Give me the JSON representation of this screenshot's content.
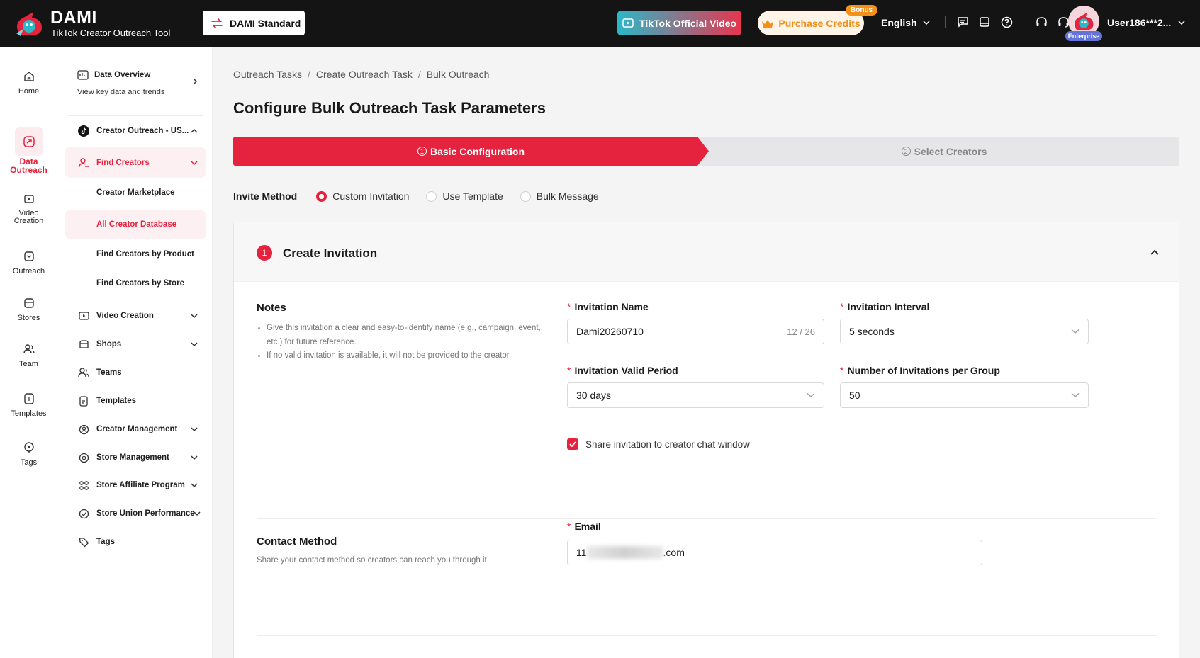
{
  "header": {
    "brand_name": "DAMI",
    "brand_sub": "TikTok Creator Outreach Tool",
    "plan_label": "DAMI Standard",
    "video_button": "TikTok Official Video",
    "credits_button": "Purchase Credits",
    "bonus_badge": "Bonus",
    "language": "English",
    "enterprise_badge": "Enterprise",
    "username": "User186***2...",
    "icons": [
      "chat-icon",
      "screen-icon",
      "help-icon",
      "headset-icon",
      "support-icon"
    ]
  },
  "rail": {
    "items": [
      {
        "label": "Home",
        "icon": "home-icon"
      },
      {
        "label": "Data Outreach",
        "icon": "outreach-icon",
        "active": true
      },
      {
        "label": "Video Creation",
        "icon": "video-icon"
      },
      {
        "label": "Outreach",
        "icon": "mail-icon"
      },
      {
        "label": "Stores",
        "icon": "store-icon"
      },
      {
        "label": "Team",
        "icon": "team-icon"
      },
      {
        "label": "Templates",
        "icon": "template-icon"
      },
      {
        "label": "Tags",
        "icon": "tag-icon"
      }
    ]
  },
  "subnav": {
    "data_overview_title": "Data Overview",
    "data_overview_sub": "View key data and trends",
    "creator_outreach": "Creator Outreach - US...",
    "find_creators": "Find Creators",
    "creator_marketplace": "Creator Marketplace",
    "all_creator_database": "All Creator Database",
    "find_by_product": "Find Creators by Product",
    "find_by_store": "Find Creators by Store",
    "video_creation": "Video Creation",
    "shops": "Shops",
    "teams": "Teams",
    "templates": "Templates",
    "creator_management": "Creator Management",
    "store_management": "Store Management",
    "store_affiliate": "Store Affiliate Program",
    "store_union": "Store Union Performance",
    "tags": "Tags"
  },
  "main": {
    "breadcrumb": [
      "Outreach Tasks",
      "Create Outreach Task",
      "Bulk Outreach"
    ],
    "title": "Configure Bulk Outreach Task Parameters",
    "steps": [
      {
        "num": "1",
        "label": "Basic Configuration",
        "active": true
      },
      {
        "num": "2",
        "label": "Select Creators",
        "active": false
      }
    ],
    "invite_method_label": "Invite Method",
    "invite_methods": [
      {
        "label": "Custom Invitation",
        "selected": true
      },
      {
        "label": "Use Template",
        "selected": false
      },
      {
        "label": "Bulk Message",
        "selected": false
      }
    ],
    "section": {
      "num": "1",
      "title": "Create Invitation",
      "notes_title": "Notes",
      "notes": [
        "Give this invitation a clear and easy-to-identify name (e.g., campaign, event, etc.) for future reference.",
        "If no valid invitation is available, it will not be provided to the creator."
      ],
      "invitation_name_label": "Invitation Name",
      "invitation_name_value": "Dami20260710",
      "invitation_name_count": "12 / 26",
      "interval_label": "Invitation Interval",
      "interval_value": "5 seconds",
      "valid_period_label": "Invitation Valid Period",
      "valid_period_value": "30 days",
      "per_group_label": "Number of Invitations per Group",
      "per_group_value": "50",
      "share_label": "Share invitation to creator chat window",
      "share_checked": true
    },
    "contact": {
      "title": "Contact Method",
      "subtitle": "Share your contact method so creators can reach you through it.",
      "email_label": "Email",
      "email_prefix": "11",
      "email_suffix": ".com"
    }
  },
  "colors": {
    "accent": "#e5233e",
    "topbar": "#141414",
    "credits": "#f29019"
  }
}
